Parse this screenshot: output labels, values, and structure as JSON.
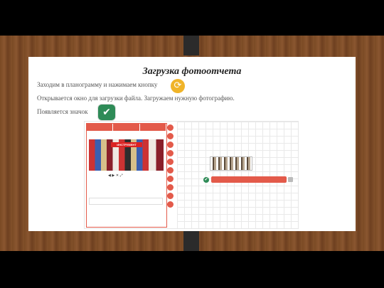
{
  "slide": {
    "title": "Загрузка фотоотчета",
    "line1": "Заходим в планограмму и нажимаем кнопку",
    "line2": "Открывается окно для загрузки файла. Загружаем нужную фотографию.",
    "line3": "Появляется значок"
  },
  "icons": {
    "sync": "sync-icon",
    "check": "check-icon"
  },
  "colors": {
    "accent": "#e35a4a",
    "success": "#2e8b57",
    "sync": "#f0b429"
  },
  "embedded": {
    "brand": "ИНСТРУМЕНТ"
  }
}
